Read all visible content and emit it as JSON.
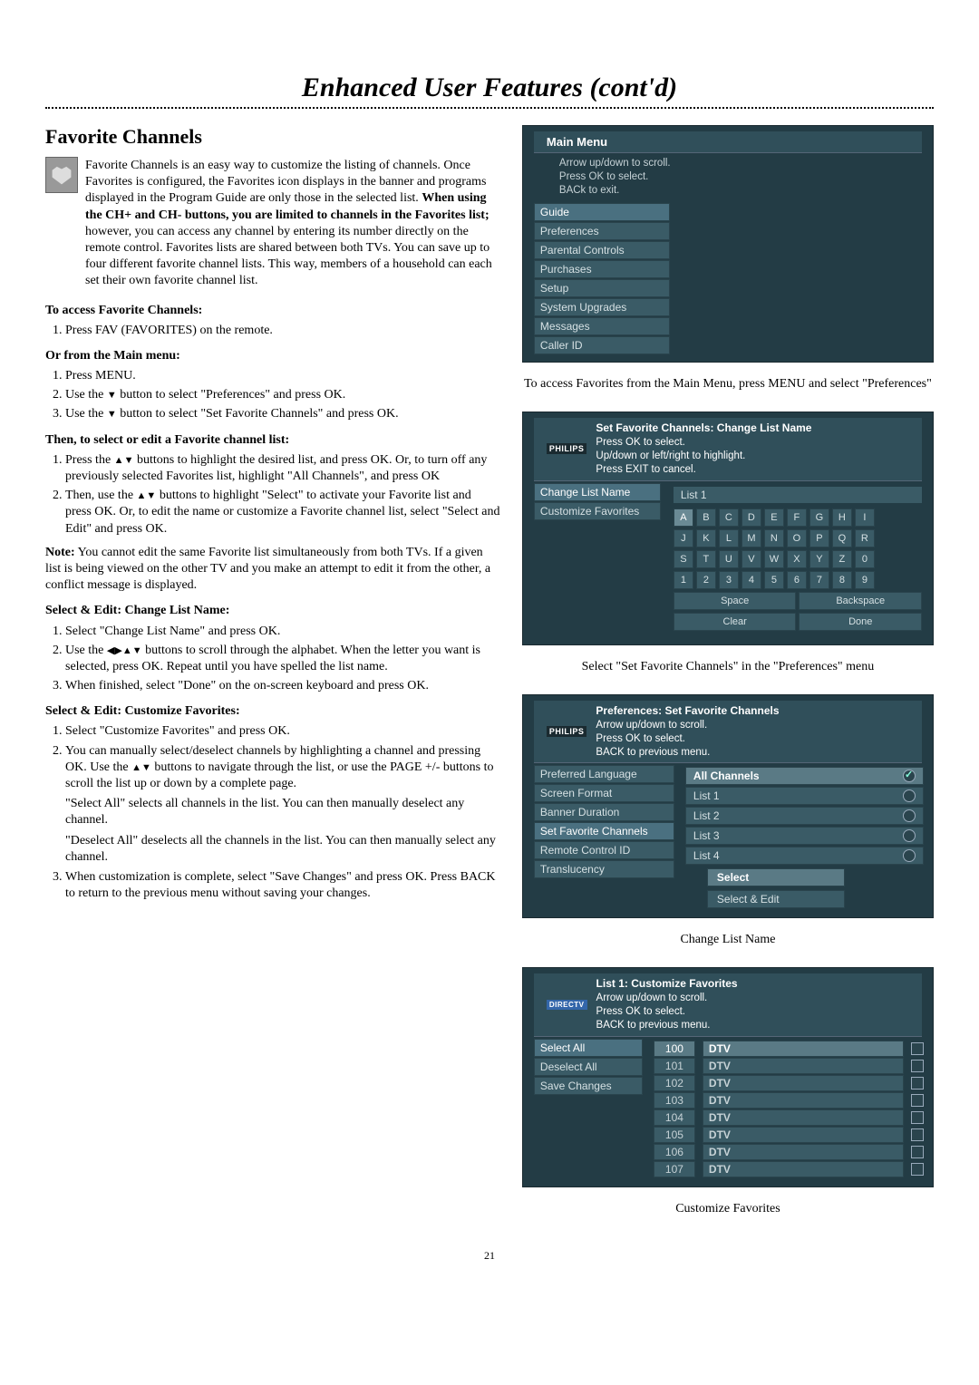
{
  "page_title": "Enhanced User Features (cont'd)",
  "page_number": "21",
  "section_heading": "Favorite Channels",
  "intro": "Favorite Channels is an easy way to customize the listing of channels. Once Favorites is configured, the Favorites icon displays in the banner and programs displayed in the Program Guide are only those in the selected list.",
  "intro_bold": "When using the CH+ and CH- buttons, you are limited to channels in the Favorites list;",
  "intro_cont": " however, you can access any channel by entering its number directly on the remote control. Favorites lists are shared between both TVs. You can save up to four different favorite channel lists. This way, members of a household can each set their own favorite channel list.",
  "access_heading": "To access Favorite Channels:",
  "access_1": "Press FAV (FAVORITES) on the remote.",
  "or_heading": "Or from the Main menu:",
  "or_1": "Press MENU.",
  "or_2_a": "Use the ",
  "or_2_b": " button to select \"Preferences\" and press OK.",
  "or_3_a": "Use the ",
  "or_3_b": " button to select \"Set Favorite Channels\" and press OK.",
  "then_heading": "Then, to select or edit a Favorite channel list:",
  "then_1_a": "Press the ",
  "then_1_b": " buttons to highlight the desired list, and press OK. Or, to turn off any previously selected Favorites list, highlight \"All Channels\", and press OK",
  "then_2_a": "Then, use the ",
  "then_2_b": " buttons to highlight \"Select\" to activate your Favorite list and press OK. Or, to edit the name or customize a Favorite channel list, select \"Select and Edit\" and press OK.",
  "note_bold": "Note:",
  "note": " You cannot edit the same Favorite list simultaneously from both TVs. If a given list is being viewed on the other TV and you make an attempt to edit it from the other, a conflict message is displayed.",
  "sel_name_heading": "Select & Edit: Change List Name:",
  "sel_name_1": "Select \"Change List Name\" and press OK.",
  "sel_name_2_a": "Use the ",
  "sel_name_2_b": " buttons to scroll through the alphabet. When the letter you want is selected, press OK. Repeat until you have spelled the list name.",
  "sel_name_3": "When finished, select \"Done\" on the on-screen keyboard and press OK.",
  "sel_cust_heading": "Select & Edit: Customize Favorites:",
  "sel_cust_1": "Select \"Customize Favorites\" and press OK.",
  "sel_cust_2_a": "You can manually select/deselect channels by highlighting a channel and pressing OK. Use the ",
  "sel_cust_2_b": " buttons to navigate through the list, or use the PAGE +/- buttons to scroll the list up or down by a complete page.",
  "sel_cust_p1": "\"Select All\" selects all channels in the list. You can then manually deselect any channel.",
  "sel_cust_p2": "\"Deselect All\" deselects all the channels in the list. You can then manually select any channel.",
  "sel_cust_3": "When customization is complete, select \"Save Changes\" and press OK. Press BACK to return to the previous menu without saving your changes.",
  "screen1": {
    "title": "Main Menu",
    "hint1": "Arrow up/down to scroll.",
    "hint2": "Press OK to select.",
    "hint3": "BACk to exit.",
    "items": [
      "Guide",
      "Preferences",
      "Parental Controls",
      "Purchases",
      "Setup",
      "System Upgrades",
      "Messages",
      "Caller ID"
    ],
    "caption": "To access Favorites from the Main Menu, press MENU and select \"Preferences\""
  },
  "screen2": {
    "logo": "PHILIPS",
    "title": "Set Favorite Channels: Change List Name",
    "hint1": "Press OK to select.",
    "hint2": "Up/down or left/right to highlight.",
    "hint3": "Press EXIT to cancel.",
    "menu": [
      "Change List Name",
      "Customize Favorites"
    ],
    "list_label": "List 1",
    "row1": [
      "A",
      "B",
      "C",
      "D",
      "E",
      "F",
      "G",
      "H",
      "I"
    ],
    "row2": [
      "J",
      "K",
      "L",
      "M",
      "N",
      "O",
      "P",
      "Q",
      "R"
    ],
    "row3": [
      "S",
      "T",
      "U",
      "V",
      "W",
      "X",
      "Y",
      "Z",
      "0"
    ],
    "row4": [
      "1",
      "2",
      "3",
      "4",
      "5",
      "6",
      "7",
      "8",
      "9"
    ],
    "space": "Space",
    "backspace": "Backspace",
    "clear": "Clear",
    "done": "Done",
    "caption": "Select \"Set Favorite Channels\" in the \"Preferences\" menu"
  },
  "screen3": {
    "logo": "PHILIPS",
    "title": "Preferences: Set Favorite Channels",
    "hint1": "Arrow up/down to scroll.",
    "hint2": "Press OK to select.",
    "hint3": "BACK to previous menu.",
    "menu": [
      "Preferred Language",
      "Screen Format",
      "Banner Duration",
      "Set Favorite Channels",
      "Remote Control ID",
      "Translucency"
    ],
    "lists": [
      "All Channels",
      "List 1",
      "List 2",
      "List 3",
      "List 4"
    ],
    "select": "Select",
    "select_edit": "Select & Edit",
    "caption": "Change List Name"
  },
  "screen4": {
    "logo": "DIRECTV",
    "title": "List 1: Customize Favorites",
    "hint1": "Arrow up/down to scroll.",
    "hint2": "Press OK to select.",
    "hint3": "BACK to previous menu.",
    "menu": [
      "Select All",
      "Deselect All",
      "Save Changes"
    ],
    "channels": [
      {
        "num": "100",
        "name": "DTV"
      },
      {
        "num": "101",
        "name": "DTV"
      },
      {
        "num": "102",
        "name": "DTV"
      },
      {
        "num": "103",
        "name": "DTV"
      },
      {
        "num": "104",
        "name": "DTV"
      },
      {
        "num": "105",
        "name": "DTV"
      },
      {
        "num": "106",
        "name": "DTV"
      },
      {
        "num": "107",
        "name": "DTV"
      }
    ],
    "caption": "Customize Favorites"
  }
}
